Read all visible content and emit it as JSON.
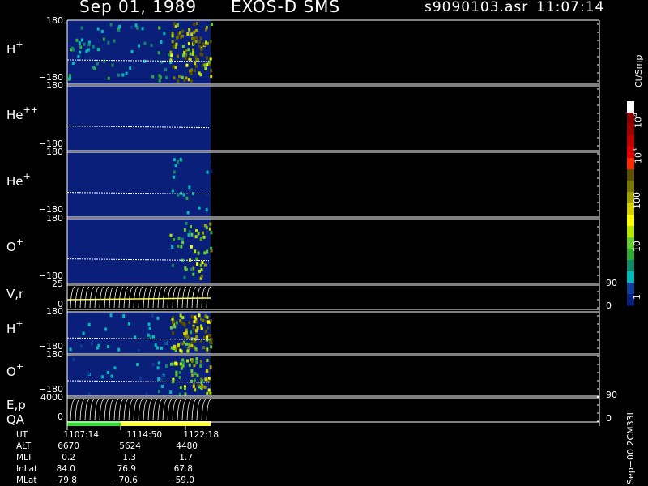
{
  "header": {
    "date": "Sep 01, 1989",
    "instrument": "EXOS-D SMS",
    "file": "s9090103.asr",
    "time": "11:07:14"
  },
  "panels": [
    {
      "base": "H",
      "charge": "+",
      "top": "180",
      "bottom": "−180"
    },
    {
      "base": "He",
      "charge": "++",
      "top": "180",
      "bottom": "−180"
    },
    {
      "base": "He",
      "charge": "+",
      "top": "180",
      "bottom": "−180"
    },
    {
      "base": "O",
      "charge": "+",
      "top": "180",
      "bottom": "−180"
    },
    {
      "base": "V,r",
      "charge": "",
      "top": "25",
      "bottom": "0",
      "right_top": "90",
      "right_bottom": "0"
    },
    {
      "base": "H",
      "charge": "+",
      "top": "180",
      "bottom": "−180"
    },
    {
      "base": "O",
      "charge": "+",
      "top": "180",
      "bottom": "−180"
    },
    {
      "base": "E,p",
      "charge": "",
      "top": "4000",
      "bottom": "0",
      "right_top": "90",
      "right_bottom": "0"
    }
  ],
  "qa_label": "QA",
  "colorbar": {
    "unit": "Ct/Smp",
    "labels": [
      "10",
      "4",
      "10",
      "3",
      "100",
      "10",
      "1"
    ],
    "colors": [
      "#ffffff",
      "#8b0000",
      "#a00000",
      "#c00000",
      "#e00000",
      "#ff2a00",
      "#5a5000",
      "#787800",
      "#a0a000",
      "#d2d200",
      "#ffff00",
      "#b4e600",
      "#66cc33",
      "#33aa33",
      "#118866",
      "#00bbbb",
      "#0d3d99",
      "#0a1f7a"
    ]
  },
  "side_label": "Sep−00  2CM33L",
  "ut_table": {
    "rows": [
      {
        "label": "UT",
        "values": [
          "1107:14",
          "1114:50",
          "1122:18"
        ]
      },
      {
        "label": "ALT",
        "values": [
          "6670",
          "5624",
          "4480"
        ]
      },
      {
        "label": "MLT",
        "values": [
          "0.2",
          "1.3",
          "1.7"
        ]
      },
      {
        "label": "InLat",
        "values": [
          "84.0",
          "76.9",
          "67.8"
        ]
      },
      {
        "label": "MLat",
        "values": [
          "−79.8",
          "−70.6",
          "−59.0"
        ]
      }
    ]
  },
  "chart_data": {
    "type": "heatmap",
    "title": "Sep 01, 1989   EXOS-D SMS",
    "x": [
      "1107:14",
      "1114:50",
      "1122:18"
    ],
    "yrange_angle": [
      -180,
      180
    ],
    "series": [
      {
        "name": "H+",
        "intensity_by_segment": [
          0.3,
          0.26,
          0.22,
          0.18,
          0.28,
          0.85,
          0.95
        ]
      },
      {
        "name": "He++",
        "intensity_by_segment": [
          0.0,
          0.0,
          0.0,
          0.0,
          0.0,
          0.0,
          0.0
        ]
      },
      {
        "name": "He+",
        "intensity_by_segment": [
          0.02,
          0.03,
          0.05,
          0.02,
          0.06,
          0.25,
          0.15
        ]
      },
      {
        "name": "O+",
        "intensity_by_segment": [
          0.02,
          0.02,
          0.03,
          0.03,
          0.06,
          0.35,
          0.6
        ]
      },
      {
        "name": "H+",
        "intensity_by_segment": [
          0.12,
          0.15,
          0.14,
          0.12,
          0.18,
          0.75,
          0.95
        ]
      },
      {
        "name": "O+",
        "intensity_by_segment": [
          0.1,
          0.15,
          0.12,
          0.1,
          0.2,
          0.45,
          0.65
        ]
      }
    ],
    "qa": [
      {
        "from": "1107:14",
        "to": "1114:50",
        "status": "green"
      },
      {
        "from": "1114:50",
        "to": "1122:18",
        "status": "yellow"
      }
    ]
  }
}
